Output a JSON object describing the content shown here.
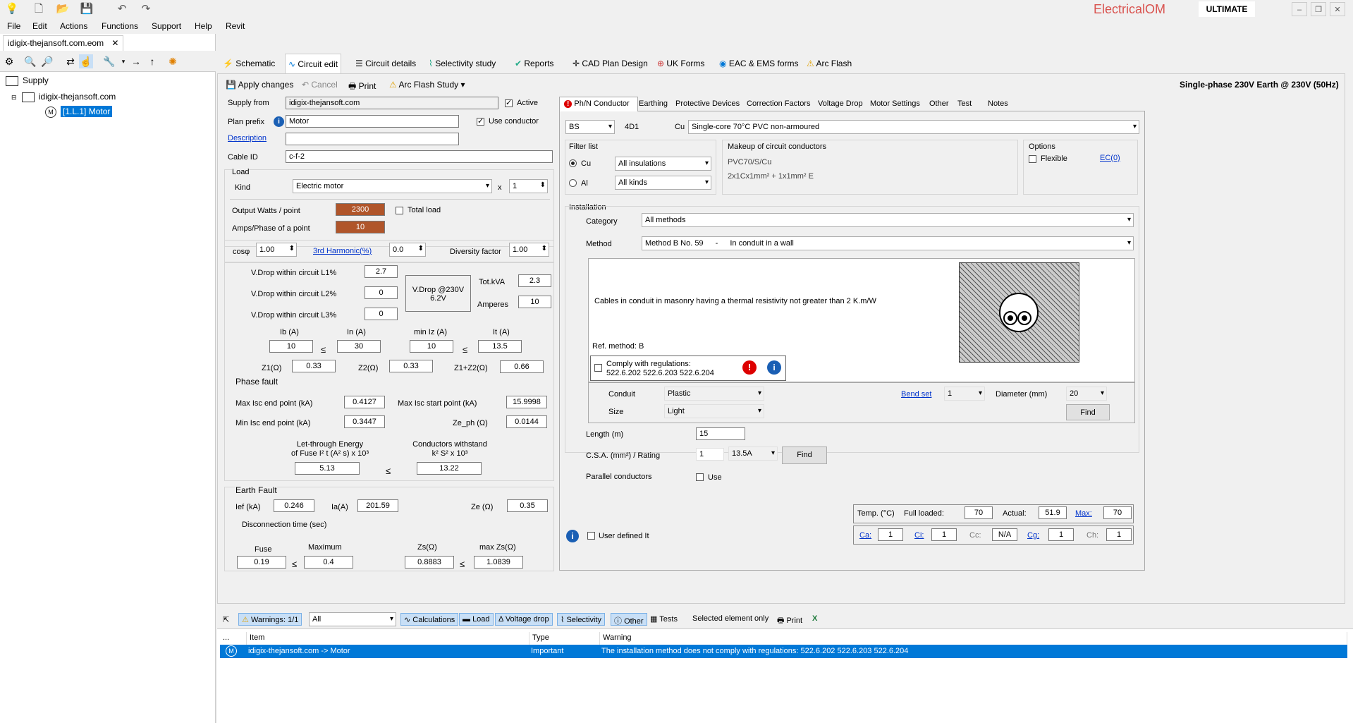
{
  "titlebar": {
    "brand": "ElectricalOM",
    "edition": "ULTIMATE"
  },
  "menu": [
    "File",
    "Edit",
    "Actions",
    "Functions",
    "Support",
    "Help",
    "Revit"
  ],
  "project": {
    "tab": "idigix-thejansoft.com.eom",
    "tree_root": "Supply",
    "tree_child": "idigix-thejansoft.com",
    "tree_leaf": "[1.L.1] Motor"
  },
  "main_tabs": [
    "Schematic",
    "Circuit edit",
    "Circuit details",
    "Selectivity study",
    "Reports",
    "CAD Plan Design",
    "UK Forms",
    "EAC & EMS forms",
    "Arc Flash"
  ],
  "toolbar": {
    "apply": "Apply changes",
    "cancel": "Cancel",
    "print": "Print",
    "arc": "Arc Flash Study",
    "supply_info": "Single-phase 230V Earth @ 230V (50Hz)"
  },
  "left": {
    "supply_from_label": "Supply from",
    "supply_from": "idigix-thejansoft.com",
    "active": "Active",
    "plan_prefix_label": "Plan prefix",
    "plan_prefix": "Motor",
    "use_conductor": "Use conductor",
    "description_label": "Description",
    "cable_id_label": "Cable ID",
    "cable_id": "c-f-2",
    "load_label": "Load",
    "kind_label": "Kind",
    "kind": "Electric motor",
    "x": "x",
    "multiplier": "1",
    "output_label": "Output Watts / point",
    "output": "2300",
    "total_load": "Total load",
    "amps_label": "Amps/Phase of a point",
    "amps": "10",
    "cos_label": "cosφ",
    "cos": "1.00",
    "harmonic_label": "3rd Harmonic(%)",
    "harmonic": "0.0",
    "diversity_label": "Diversity factor",
    "diversity": "1.00",
    "vd1_label": "V.Drop within circuit L1%",
    "vd1": "2.7",
    "vd2_label": "V.Drop within circuit L2%",
    "vd2": "0",
    "vd3_label": "V.Drop within circuit L3%",
    "vd3": "0",
    "vdrop_box1": "V.Drop @230V",
    "vdrop_box2": "6.2V",
    "totkva_label": "Tot.kVA",
    "totkva": "2.3",
    "amperes_label": "Amperes",
    "amperes": "10",
    "ib_label": "Ib (A)",
    "ib": "10",
    "in_label": "In (A)",
    "in": "30",
    "miniz_label": "min Iz (A)",
    "miniz": "10",
    "it_label": "It (A)",
    "it": "13.5",
    "z1_label": "Z1(Ω)",
    "z1": "0.33",
    "z2_label": "Z2(Ω)",
    "z2": "0.33",
    "z12_label": "Z1+Z2(Ω)",
    "z12": "0.66",
    "le": "≤",
    "phase_fault": "Phase fault",
    "maxisc_end_label": "Max Isc end point (kA)",
    "maxisc_end": "0.4127",
    "maxisc_start_label": "Max Isc start point (kA)",
    "maxisc_start": "15.9998",
    "minisc_end_label": "Min Isc end point (kA)",
    "minisc_end": "0.3447",
    "zeph_label": "Ze_ph (Ω)",
    "zeph": "0.0144",
    "letthrough_1": "Let-through Energy",
    "letthrough_2": "of Fuse I² t (A² s)  x 10³",
    "withstand_1": "Conductors withstand",
    "withstand_2": "k² S²  x 10³",
    "letthrough": "5.13",
    "withstand": "13.22",
    "earth_fault": "Earth Fault",
    "ief_label": "Ief (kA)",
    "ief": "0.246",
    "ia_label": "Ia(A)",
    "ia": "201.59",
    "ze_label": "Ze (Ω)",
    "ze": "0.35",
    "disc_label": "Disconnection time (sec)",
    "fuse_label": "Fuse",
    "fuse": "0.19",
    "max_label": "Maximum",
    "max": "0.4",
    "zs_label": "Zs(Ω)",
    "zs": "0.8883",
    "maxzs_label": "max Zs(Ω)",
    "maxzs": "1.0839"
  },
  "right_tabs": [
    "Ph/N Conductor",
    "Earthing",
    "Protective Devices",
    "Correction Factors",
    "Voltage Drop",
    "Motor Settings",
    "Other",
    "Test",
    "Notes"
  ],
  "right": {
    "std": "BS",
    "code": "4D1",
    "material": "Cu",
    "cable_desc": "Single-core 70°C PVC non-armoured",
    "filter_label": "Filter list",
    "cu": "Cu",
    "al": "Al",
    "insulations": "All insulations",
    "kinds": "All kinds",
    "makeup_label": "Makeup of circuit conductors",
    "makeup1": "PVC70/S/Cu",
    "makeup2": "2x1Cx1mm² + 1x1mm² E",
    "options_label": "Options",
    "flexible": "Flexible",
    "ec": "EC(0)",
    "installation_label": "Installation",
    "category_label": "Category",
    "category": "All methods",
    "method_label": "Method",
    "method": "Method B No. 59",
    "method_dash": "-",
    "method_desc": "In conduit in a wall",
    "install_desc": "Cables in conduit in masonry having a thermal resistivity not greater than 2 K.m/W",
    "ref_method": "Ref. method: B",
    "comply_1": "Comply with regulations:",
    "comply_2": "522.6.202 522.6.203 522.6.204",
    "conduit_label": "Conduit",
    "conduit": "Plastic",
    "size_label": "Size",
    "size": "Light",
    "bend_label": "Bend set",
    "bend": "1",
    "diameter_label": "Diameter (mm)",
    "diameter": "20",
    "find": "Find",
    "length_label": "Length (m)",
    "length": "15",
    "csa_label": "C.S.A. (mm²) / Rating",
    "csa": "1",
    "rating": "13.5A",
    "parallel_label": "Parallel conductors",
    "use": "Use",
    "user_defined": "User defined It",
    "temp_label": "Temp. (°C)",
    "full_label": "Full loaded:",
    "full": "70",
    "actual_label": "Actual:",
    "actual": "51.9",
    "max_label": "Max:",
    "max": "70",
    "ca_label": "Ca:",
    "ca": "1",
    "ci_label": "Ci:",
    "ci": "1",
    "cc_label": "Cc:",
    "cc": "N/A",
    "cg_label": "Cg:",
    "cg": "1",
    "ch_label": "Ch:",
    "ch": "1"
  },
  "bottom": {
    "warnings": "Warnings: 1/1",
    "filter": "All",
    "calculations": "Calculations",
    "load": "Load",
    "vdrop": "Voltage drop",
    "selectivity": "Selectivity",
    "other": "Other",
    "tests": "Tests",
    "selected_only": "Selected element only",
    "print": "Print",
    "headers": [
      "...",
      "Item",
      "Type",
      "Warning"
    ],
    "rows": [
      {
        "item": "idigix-thejansoft.com -> Motor",
        "type": "Important",
        "warning": "The installation method does not comply with regulations: 522.6.202 522.6.203 522.6.204"
      }
    ]
  },
  "colors": {
    "accent": "#0078d7",
    "orange": "#b0552a",
    "brand_red": "#d9534f"
  }
}
